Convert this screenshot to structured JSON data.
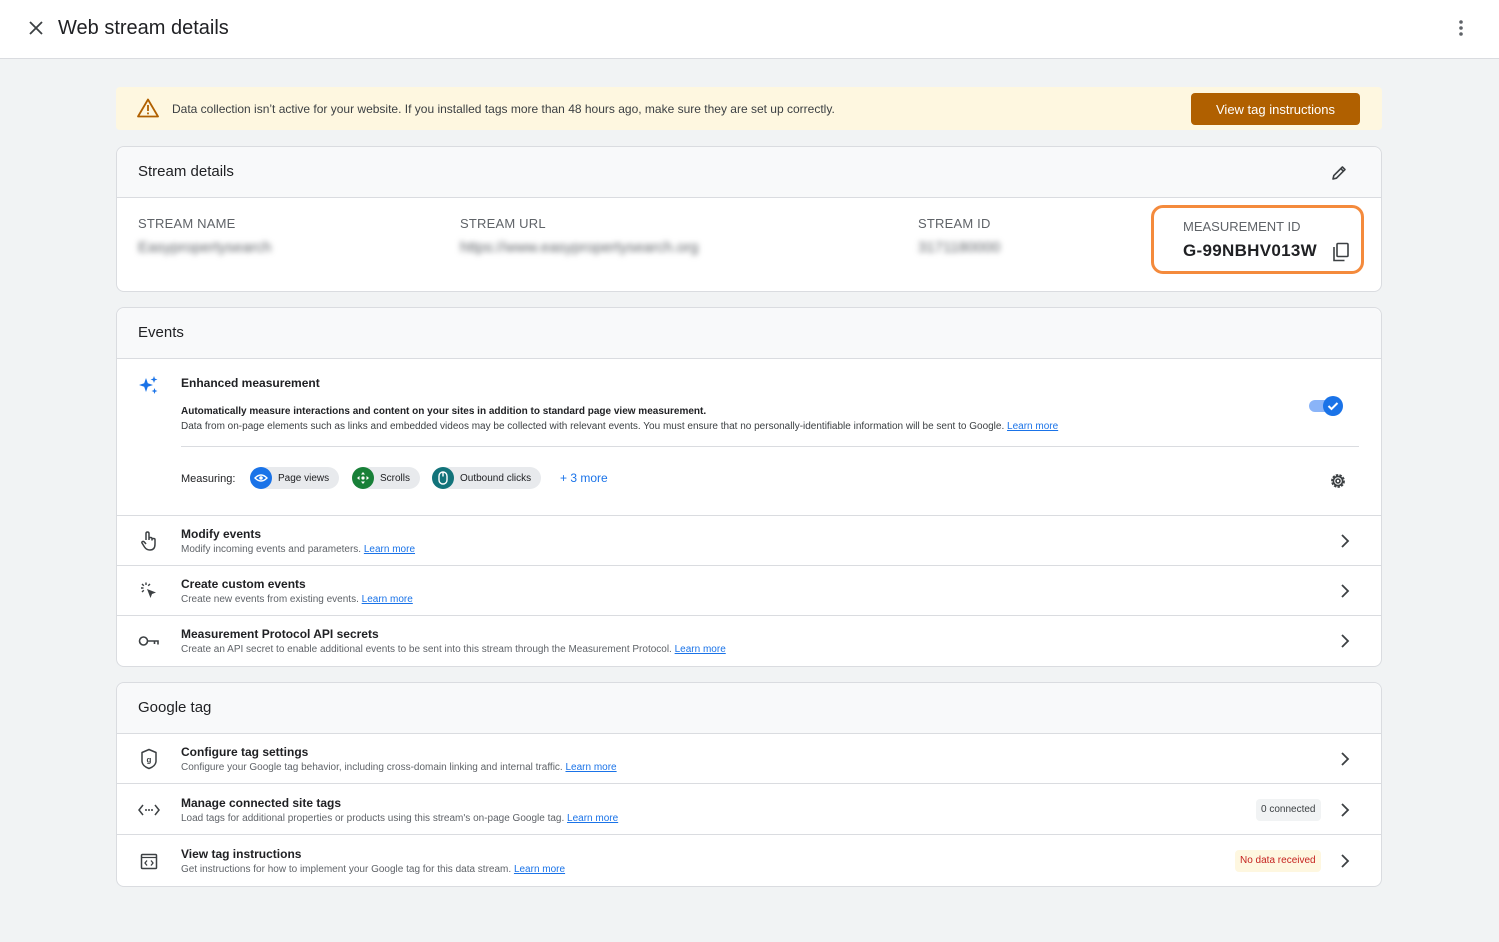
{
  "header": {
    "title": "Web stream details"
  },
  "warning": {
    "text": "Data collection isn’t active for your website. If you installed tags more than 48 hours ago, make sure they are set up correctly.",
    "button": "View tag instructions"
  },
  "stream": {
    "title": "Stream details",
    "fields": [
      {
        "label": "STREAM NAME",
        "value": "Easypropertysearch"
      },
      {
        "label": "STREAM URL",
        "value": "https://www.easypropertysearch.org"
      },
      {
        "label": "STREAM ID",
        "value": "3171180000"
      }
    ],
    "measurement": {
      "label": "MEASUREMENT ID",
      "value": "G-99NBHV013W"
    }
  },
  "events": {
    "title": "Events",
    "enhanced": {
      "title": "Enhanced measurement",
      "desc_bold": "Automatically measure interactions and content on your sites in addition to standard page view measurement.",
      "desc": "Data from on-page elements such as links and embedded videos may be collected with relevant events. You must ensure that no personally-identifiable information will be sent to Google.",
      "learn_more": "Learn more",
      "enabled": true,
      "measuring_label": "Measuring:",
      "chips": [
        "Page views",
        "Scrolls",
        "Outbound clicks"
      ],
      "more": "+ 3 more"
    },
    "rows": [
      {
        "title": "Modify events",
        "desc": "Modify incoming events and parameters.",
        "link": "Learn more"
      },
      {
        "title": "Create custom events",
        "desc": "Create new events from existing events.",
        "link": "Learn more"
      },
      {
        "title": "Measurement Protocol API secrets",
        "desc": "Create an API secret to enable additional events to be sent into this stream through the Measurement Protocol.",
        "link": "Learn more"
      }
    ]
  },
  "gtag": {
    "title": "Google tag",
    "rows": [
      {
        "title": "Configure tag settings",
        "desc": "Configure your Google tag behavior, including cross-domain linking and internal traffic.",
        "link": "Learn more"
      },
      {
        "title": "Manage connected site tags",
        "desc": "Load tags for additional properties or products using this stream's on-page Google tag.",
        "link": "Learn more",
        "badge": "0 connected"
      },
      {
        "title": "View tag instructions",
        "desc": "Get instructions for how to implement your Google tag for this data stream.",
        "link": "Learn more",
        "badge": "No data received"
      }
    ]
  },
  "colors": {
    "accent": "#1a73e8",
    "warning_button": "#b06000",
    "highlight": "#f48a3c"
  }
}
